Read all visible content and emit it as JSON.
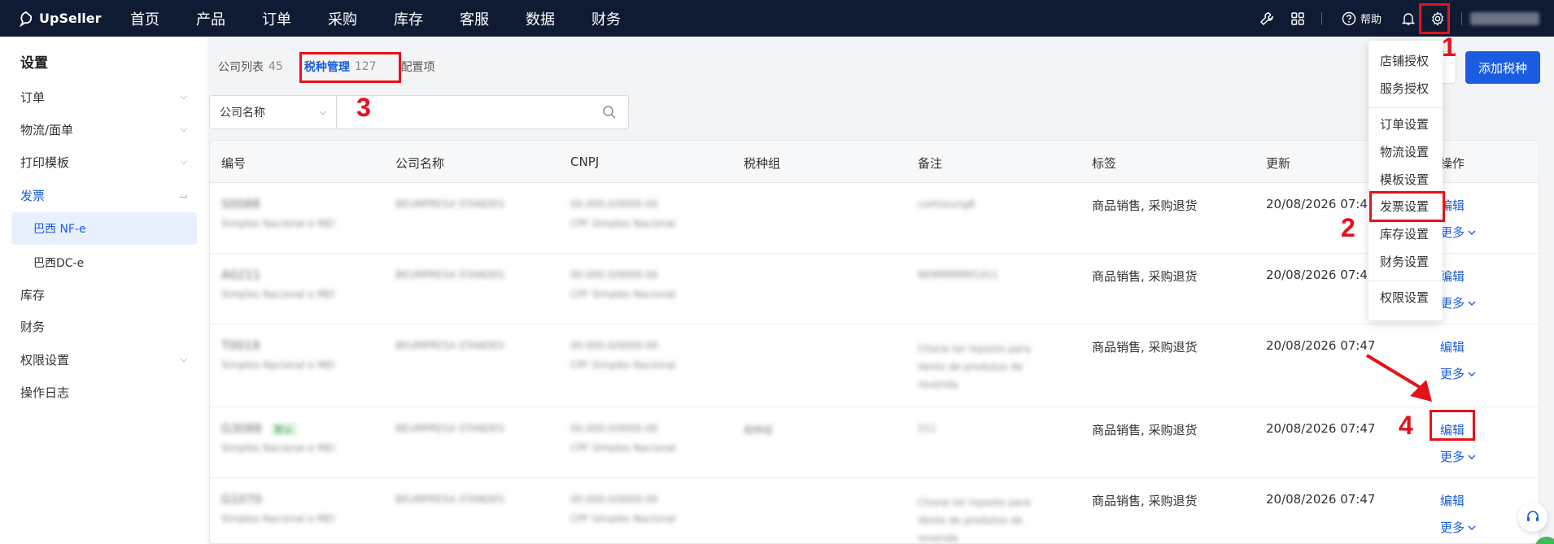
{
  "topbar": {
    "logo_text": "UpSeller",
    "nav": [
      "首页",
      "产品",
      "订单",
      "采购",
      "库存",
      "客服",
      "数据",
      "财务"
    ],
    "help_label": "帮助",
    "icons": [
      "wrench-icon",
      "apps-icon",
      "help-icon",
      "bell-icon",
      "gear-icon"
    ]
  },
  "sidebar": {
    "title": "设置",
    "items": [
      {
        "label": "订单",
        "chevron": "down"
      },
      {
        "label": "物流/面单",
        "chevron": "down"
      },
      {
        "label": "打印模板",
        "chevron": "down"
      },
      {
        "label": "发票",
        "chevron": "up",
        "active": true
      },
      {
        "label": "巴西 NF-e",
        "sub": true,
        "selected": true
      },
      {
        "label": "巴西DC-e",
        "sub": true
      },
      {
        "label": "库存"
      },
      {
        "label": "财务"
      },
      {
        "label": "权限设置",
        "chevron": "down"
      },
      {
        "label": "操作日志"
      }
    ]
  },
  "tabs": [
    {
      "label": "公司列表",
      "count": "45"
    },
    {
      "label": "税种管理",
      "count": "127",
      "active": true
    },
    {
      "label": "配置项",
      "count": ""
    }
  ],
  "search": {
    "field_select": "公司名称",
    "placeholder": ""
  },
  "add_button": "添加税种",
  "table": {
    "columns": [
      "编号",
      "公司名称",
      "CNPJ",
      "税种组",
      "备注",
      "标签",
      "更新",
      "操作"
    ],
    "rows": [
      {
        "id": "S0088",
        "id_sub": "Simples Nacional e MEI",
        "company": "BEUMPRESA STANDES",
        "cnpj": "00.000.0/0000-00",
        "cnpj_sub": "CPF Simples Nacional",
        "group": "",
        "note": "contsoung8",
        "tag": "商品销售, 采购退货",
        "updated": "20/08/2026 07:47",
        "edit": "编辑",
        "more": "更多"
      },
      {
        "id": "A0211",
        "id_sub": "Simples Nacional e MEI",
        "company": "BEUMPRESA STANDES",
        "cnpj": "00.000.0/0000-00",
        "cnpj_sub": "CPF Simples Nacional",
        "group": "",
        "note": "NEMMMMM1411",
        "tag": "商品销售, 采购退货",
        "updated": "20/08/2026 07:47",
        "edit": "编辑",
        "more": "更多"
      },
      {
        "id": "T0019",
        "id_sub": "Simples Nacional e MEI",
        "company": "BEUMPRESA STANDES",
        "cnpj": "00.000.0/0000-00",
        "cnpj_sub": "CPF Simples Nacional",
        "group": "",
        "note": "Ctione ter Inposto para Vente de produtos de revenda",
        "tag": "商品销售, 采购退货",
        "updated": "20/08/2026 07:47",
        "edit": "编辑",
        "more": "更多"
      },
      {
        "id": "G3088",
        "id_sub": "Simples Nacional e MEI",
        "badge": "默认",
        "company": "BEUMPRESA STANDES",
        "cnpj": "00.000.0/0000-00",
        "cnpj_sub": "CPF Simples Nacional",
        "group": "税种组",
        "note": "211",
        "tag": "商品销售, 采购退货",
        "updated": "20/08/2026 07:47",
        "edit": "编辑",
        "more": "更多"
      },
      {
        "id": "G1070",
        "id_sub": "Simples Nacional e MEI",
        "company": "BEUMPRESA STANDES",
        "cnpj": "00.000.0/0000-00",
        "cnpj_sub": "CPF Simples Nacional",
        "group": "",
        "note": "Ctione ter Inposto para Vente de produtos de revenda",
        "tag": "商品销售, 采购退货",
        "updated": "20/08/2026 07:47",
        "edit": "编辑",
        "more": "更多"
      }
    ]
  },
  "dropdown": {
    "groups": [
      [
        "店铺授权",
        "服务授权"
      ],
      [
        "订单设置",
        "物流设置",
        "模板设置",
        "发票设置",
        "库存设置",
        "财务设置"
      ],
      [
        "权限设置"
      ]
    ]
  },
  "annotations": [
    "1",
    "2",
    "3",
    "4"
  ],
  "colors": {
    "topbar": "#0f1b33",
    "accent": "#1a5ce0",
    "annotation": "#e5121b"
  }
}
